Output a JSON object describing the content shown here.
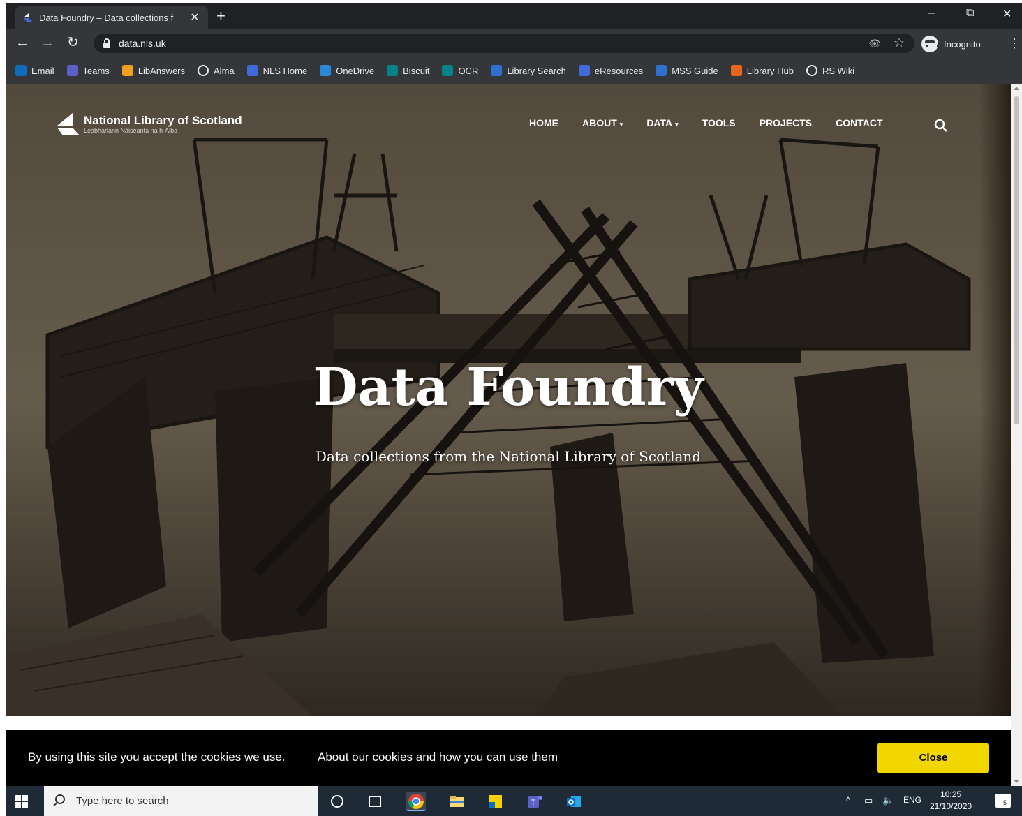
{
  "browser": {
    "tab_title": "Data Foundry – Data collections f",
    "tab_close": "✕",
    "new_tab": "+",
    "url": "data.nls.uk",
    "profile_label": "Incognito",
    "window_controls": {
      "minimize": "–",
      "restore": "⧉",
      "close": "✕"
    },
    "bookmarks": [
      {
        "label": "Email",
        "icon": "outlook-icon",
        "color": "#0f6cbd"
      },
      {
        "label": "Teams",
        "icon": "teams-icon",
        "color": "#5b5fc7"
      },
      {
        "label": "LibAnswers",
        "icon": "libanswers-icon",
        "color": "#f0a01e"
      },
      {
        "label": "Alma",
        "icon": "globe-icon",
        "color": "#e8eaed"
      },
      {
        "label": "NLS Home",
        "icon": "nls-icon",
        "color": "#3f6ad8"
      },
      {
        "label": "OneDrive",
        "icon": "onedrive-icon",
        "color": "#2b88d8"
      },
      {
        "label": "Biscuit",
        "icon": "sharepoint-icon",
        "color": "#038387"
      },
      {
        "label": "OCR",
        "icon": "sharepoint-icon",
        "color": "#038387"
      },
      {
        "label": "Library Search",
        "icon": "document-icon",
        "color": "#2f6fd0"
      },
      {
        "label": "eResources",
        "icon": "nls-icon",
        "color": "#3f6ad8"
      },
      {
        "label": "MSS Guide",
        "icon": "document-icon",
        "color": "#2f6fd0"
      },
      {
        "label": "Library Hub",
        "icon": "jisc-icon",
        "color": "#e8651d"
      },
      {
        "label": "RS Wiki",
        "icon": "globe-icon",
        "color": "#e8eaed"
      }
    ]
  },
  "site": {
    "logo_name": "National Library of Scotland",
    "logo_sub": "Leabharlann Nàiseanta na h-Alba",
    "nav": [
      {
        "label": "HOME",
        "dropdown": false
      },
      {
        "label": "ABOUT",
        "dropdown": true
      },
      {
        "label": "DATA",
        "dropdown": true
      },
      {
        "label": "TOOLS",
        "dropdown": false
      },
      {
        "label": "PROJECTS",
        "dropdown": false
      },
      {
        "label": "CONTACT",
        "dropdown": false
      }
    ],
    "hero_title": "Data Foundry",
    "hero_subtitle": "Data collections from the National Library of Scotland"
  },
  "cookie_banner": {
    "message": "By using this site you accept the cookies we use.",
    "link": "About our cookies and how you can use them",
    "button": "Close",
    "button_color": "#f1d600"
  },
  "taskbar": {
    "search_placeholder": "Type here to search",
    "language": "ENG",
    "time": "10:25",
    "date": "21/10/2020",
    "notification_count": "5"
  }
}
